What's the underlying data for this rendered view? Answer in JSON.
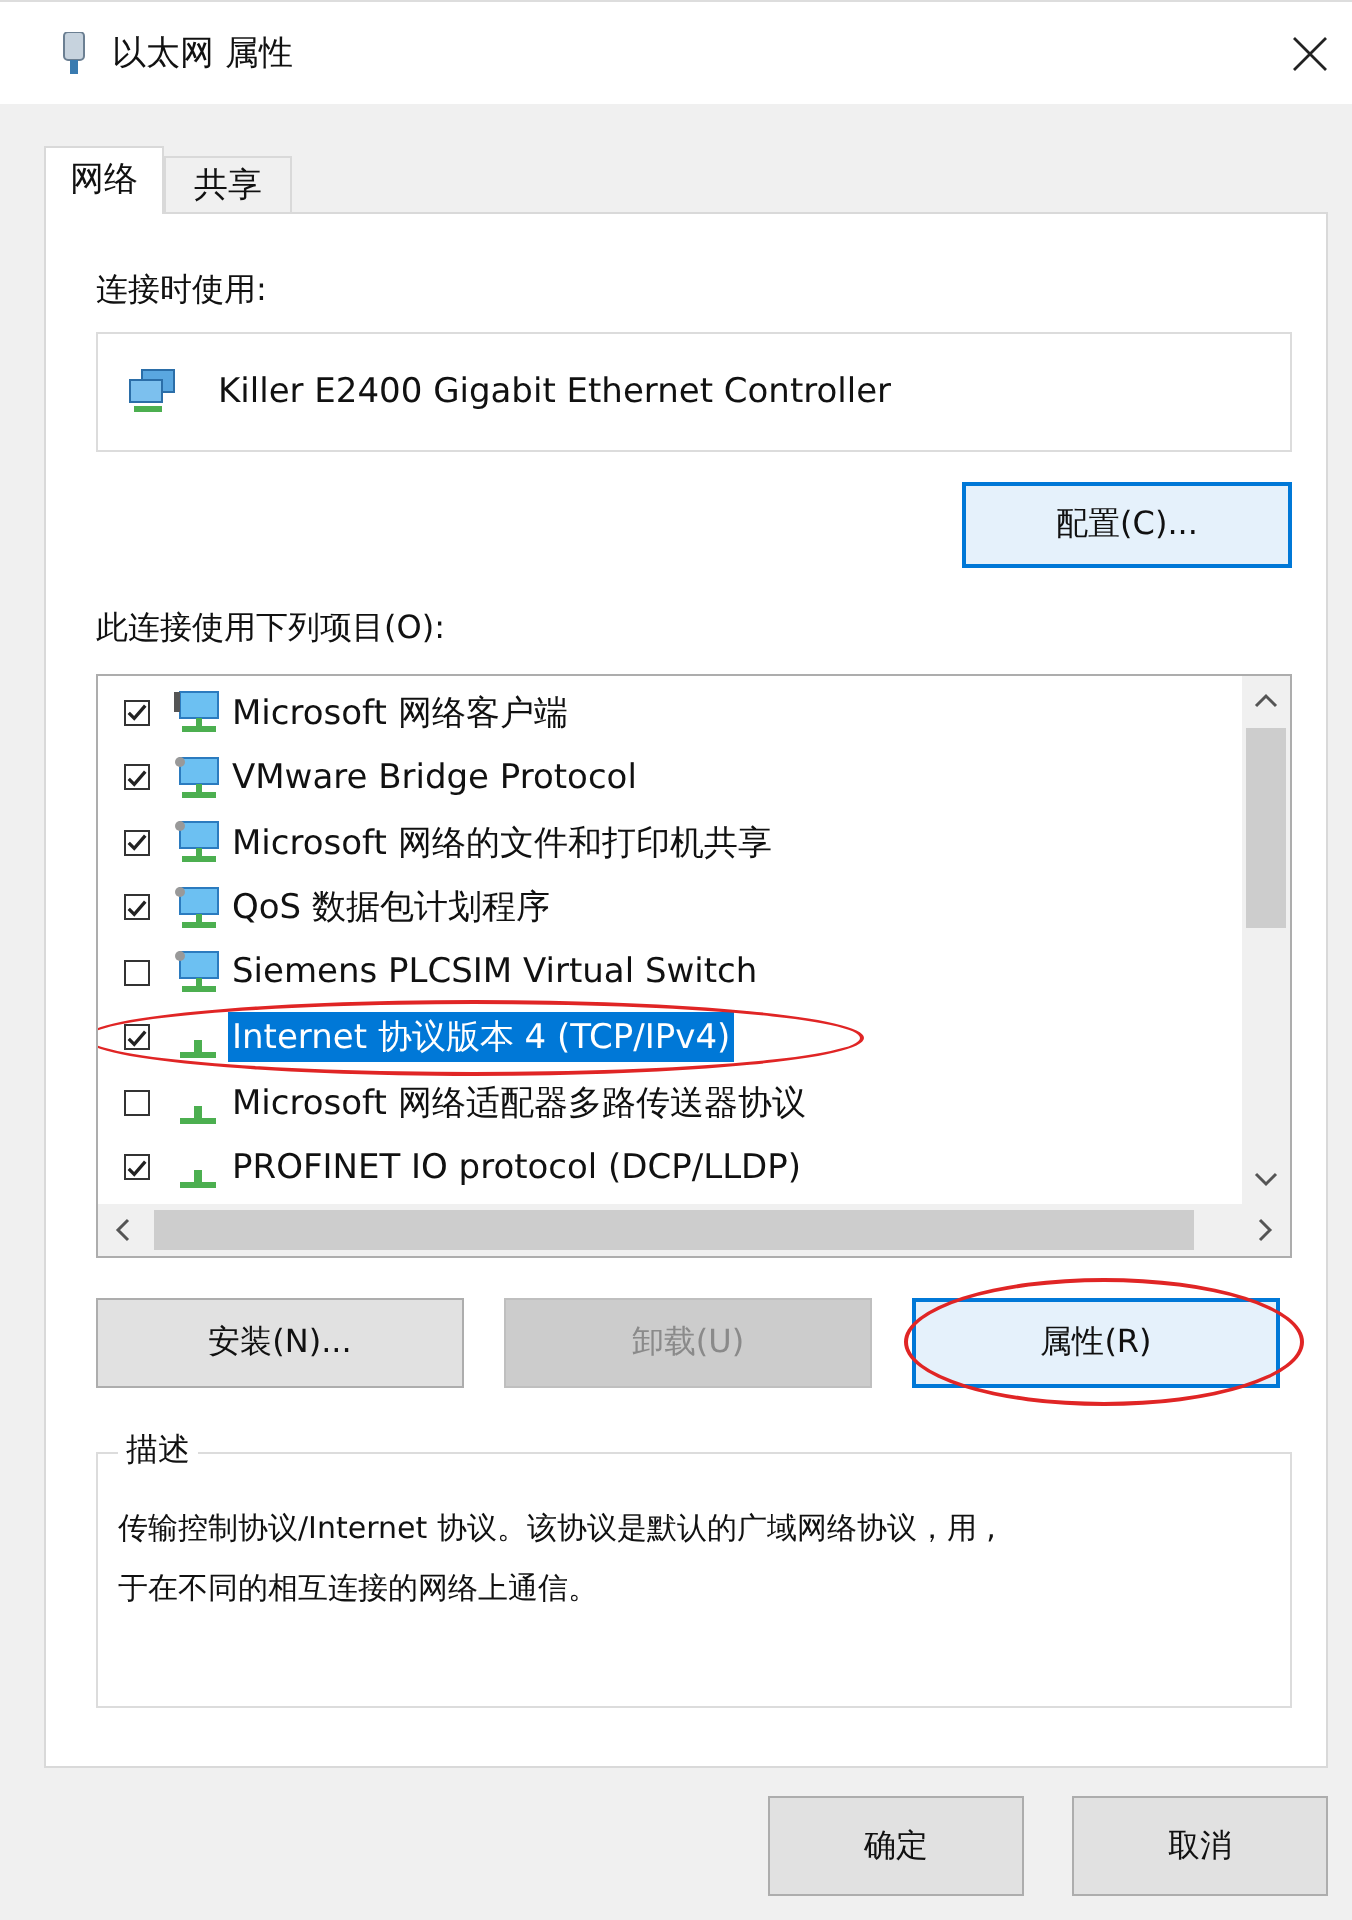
{
  "window": {
    "title": "以太网 属性"
  },
  "tabs": [
    {
      "label": "网络",
      "selected": true
    },
    {
      "label": "共享",
      "selected": false
    }
  ],
  "connect_using": {
    "label": "连接时使用:",
    "adapter": "Killer E2400 Gigabit Ethernet Controller"
  },
  "configure_button": "配置(C)...",
  "items_label": "此连接使用下列项目(O):",
  "items": [
    {
      "kind": "client",
      "label": "Microsoft 网络客户端",
      "checked": true,
      "selected": false,
      "circled": false
    },
    {
      "kind": "service",
      "label": "VMware Bridge Protocol",
      "checked": true,
      "selected": false,
      "circled": false
    },
    {
      "kind": "service",
      "label": "Microsoft 网络的文件和打印机共享",
      "checked": true,
      "selected": false,
      "circled": false
    },
    {
      "kind": "service",
      "label": "QoS 数据包计划程序",
      "checked": true,
      "selected": false,
      "circled": false
    },
    {
      "kind": "service",
      "label": "Siemens PLCSIM Virtual Switch",
      "checked": false,
      "selected": false,
      "circled": false
    },
    {
      "kind": "protocol",
      "label": "Internet 协议版本 4 (TCP/IPv4)",
      "checked": true,
      "selected": true,
      "circled": true
    },
    {
      "kind": "protocol",
      "label": "Microsoft 网络适配器多路传送器协议",
      "checked": false,
      "selected": false,
      "circled": false
    },
    {
      "kind": "protocol",
      "label": "PROFINET IO protocol (DCP/LLDP)",
      "checked": true,
      "selected": false,
      "circled": false
    }
  ],
  "item_buttons": [
    {
      "label": "安装(N)...",
      "disabled": false,
      "focused": false,
      "circled": false
    },
    {
      "label": "卸载(U)",
      "disabled": true,
      "focused": false,
      "circled": false
    },
    {
      "label": "属性(R)",
      "disabled": false,
      "focused": true,
      "circled": true
    }
  ],
  "description": {
    "title": "描述",
    "text": "传输控制协议/Internet 协议。该协议是默认的广域网络协议，用 ,\n于在不同的相互连接的网络上通信。"
  },
  "dialog_buttons": [
    "确定",
    "取消"
  ]
}
